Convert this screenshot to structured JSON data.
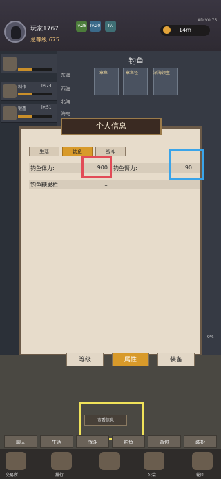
{
  "player": {
    "name": "玩家1767",
    "total_level_label": "总等级:675",
    "level_badges": [
      "lv.28",
      "lv.20",
      "lv."
    ],
    "distance": "14m",
    "version": "AD:V0.75"
  },
  "sidebar": {
    "items": [
      {
        "label": "",
        "level": ""
      },
      {
        "label": "制作",
        "level": "lv:74"
      },
      {
        "label": "锻造",
        "level": "lv:51"
      }
    ]
  },
  "fishing": {
    "title": "钓鱼",
    "locations": [
      "东海",
      "西海",
      "北海",
      "海岛"
    ],
    "cards": [
      "章鱼",
      "章鱼怪",
      "深海领主"
    ]
  },
  "modal": {
    "title": "个人信息",
    "tabs": [
      "生活",
      "钓鱼",
      "战斗"
    ],
    "active_tab": "钓鱼",
    "rows": [
      {
        "left_label": "钓鱼体力:",
        "left_value": "900",
        "right_label": "钓鱼臂力:",
        "right_value": "90"
      },
      {
        "left_label": "钓鱼糖果栏",
        "left_value": "1"
      }
    ]
  },
  "subtabs": [
    "等级",
    "属性",
    "装备"
  ],
  "active_subtab": "属性",
  "view_info_button": "查看信息",
  "percent": "0%",
  "nav_row": [
    "聊天",
    "生活",
    "战斗",
    "钓鱼",
    "背包",
    "装扮"
  ],
  "bottom_nav": [
    "交易所",
    "排行",
    "",
    "公会",
    "轮回"
  ]
}
